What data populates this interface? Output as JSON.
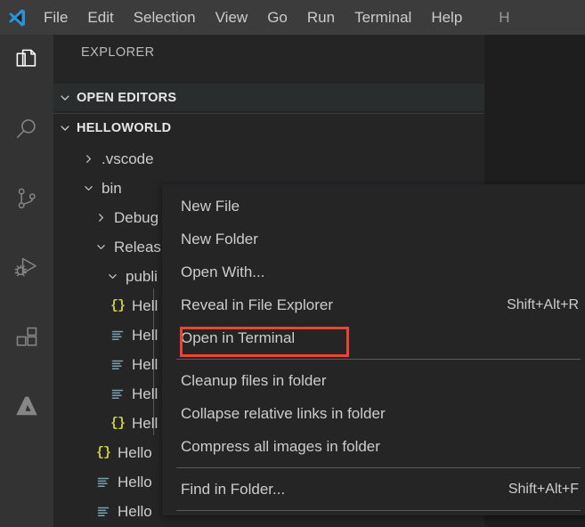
{
  "window": {
    "app_name": "Visual Studio Code",
    "logo_icon": "vscode-logo-icon"
  },
  "menubar": {
    "items": [
      {
        "label": "File"
      },
      {
        "label": "Edit"
      },
      {
        "label": "Selection"
      },
      {
        "label": "View"
      },
      {
        "label": "Go"
      },
      {
        "label": "Run"
      },
      {
        "label": "Terminal"
      },
      {
        "label": "Help"
      },
      {
        "label": "H"
      }
    ]
  },
  "activitybar": {
    "items": [
      {
        "name": "explorer",
        "icon": "files-icon",
        "active": true
      },
      {
        "name": "search",
        "icon": "search-icon",
        "active": false
      },
      {
        "name": "source-control",
        "icon": "source-control-branch-icon",
        "active": false
      },
      {
        "name": "run-and-debug",
        "icon": "run-debug-icon",
        "active": false
      },
      {
        "name": "extensions",
        "icon": "extensions-blocks-icon",
        "active": false
      },
      {
        "name": "azure",
        "icon": "azure-logo-icon",
        "active": false
      }
    ]
  },
  "sidebar": {
    "title": "EXPLORER",
    "sections": [
      {
        "label": "OPEN EDITORS",
        "expanded": true
      },
      {
        "label": "HELLOWORLD",
        "expanded": true
      }
    ],
    "tree": [
      {
        "label": ".vscode",
        "depth": 1,
        "type": "folder",
        "expanded": false
      },
      {
        "label": "bin",
        "depth": 1,
        "type": "folder",
        "expanded": true
      },
      {
        "label": "Debug",
        "depth": 2,
        "type": "folder",
        "expanded": false
      },
      {
        "label": "Releas",
        "depth": 2,
        "type": "folder",
        "expanded": true
      },
      {
        "label": "publi",
        "depth": 3,
        "type": "folder",
        "expanded": true
      },
      {
        "label": "Hell",
        "depth": 4,
        "type": "json"
      },
      {
        "label": "Hell",
        "depth": 4,
        "type": "config"
      },
      {
        "label": "Hell",
        "depth": 4,
        "type": "config"
      },
      {
        "label": "Hell",
        "depth": 4,
        "type": "config"
      },
      {
        "label": "Hell",
        "depth": 4,
        "type": "json"
      },
      {
        "label": "Hello",
        "depth": 3,
        "type": "json"
      },
      {
        "label": "Hello",
        "depth": 3,
        "type": "config"
      },
      {
        "label": "Hello",
        "depth": 3,
        "type": "config"
      }
    ]
  },
  "context_menu": {
    "items": [
      {
        "label": "New File",
        "shortcut": "",
        "type": "item"
      },
      {
        "label": "New Folder",
        "shortcut": "",
        "type": "item"
      },
      {
        "label": "Open With...",
        "shortcut": "",
        "type": "item"
      },
      {
        "label": "Reveal in File Explorer",
        "shortcut": "Shift+Alt+R",
        "type": "item"
      },
      {
        "label": "Open in Terminal",
        "shortcut": "",
        "type": "item",
        "highlighted": true
      },
      {
        "type": "separator"
      },
      {
        "label": "Cleanup files in folder",
        "shortcut": "",
        "type": "item"
      },
      {
        "label": "Collapse relative links in folder",
        "shortcut": "",
        "type": "item"
      },
      {
        "label": "Compress all images in folder",
        "shortcut": "",
        "type": "item"
      },
      {
        "type": "separator"
      },
      {
        "label": "Find in Folder...",
        "shortcut": "Shift+Alt+F",
        "type": "item"
      },
      {
        "type": "separator"
      }
    ]
  },
  "annotation": {
    "target_label": "Open in Terminal",
    "color": "#ef4136"
  },
  "colors": {
    "titlebar_bg": "#3c3c3c",
    "activitybar_bg": "#333333",
    "sidebar_bg": "#252526",
    "editor_bg": "#1e1e1e",
    "menu_bg": "#252526",
    "text": "#cccccc",
    "accent_red": "#ef4136",
    "json_icon": "#cbcb41",
    "config_icon": "#6d8086"
  }
}
